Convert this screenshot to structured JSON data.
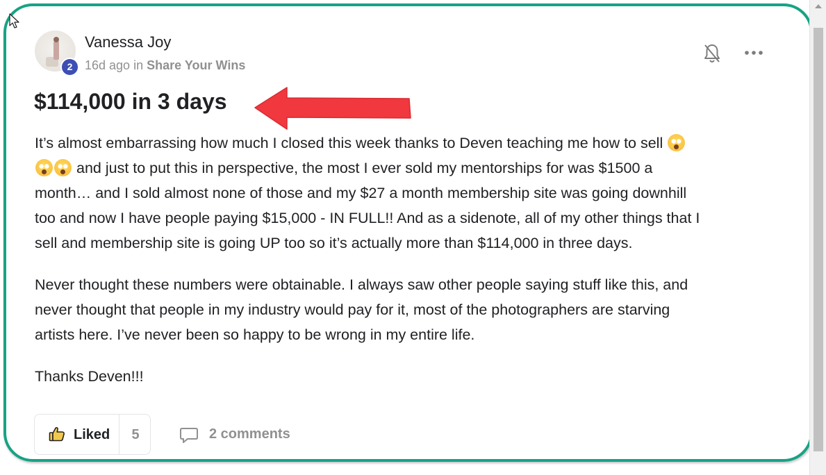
{
  "post": {
    "author": "Vanessa Joy",
    "level": "2",
    "time": "16d ago",
    "in_word": "in",
    "category": "Share Your Wins",
    "title": "$114,000 in 3 days",
    "paragraph1_lines": [
      "It’s almost embarrassing how much I closed this week thanks to Deven teaching me how to sell",
      "and just to put this in perspective, the most I ever sold my mentorships for was $1500 a",
      "month… and I sold almost none of those and my $27 a month membership site was going downhill",
      "too and now I have people paying $15,000 - IN FULL!! And as a sidenote, all of my other things that I",
      "sell and membership site is going UP too so it’s actually more than $114,000 in three days."
    ],
    "paragraph2_lines": [
      "Never thought these numbers were obtainable. I always saw other people saying stuff like this, and",
      "never thought that people in my industry would pay for it, most of the photographers are starving",
      "artists here. I’ve never been so happy to be wrong in my entire life."
    ],
    "paragraph3": "Thanks Deven!!!",
    "emoji_icon": "flushed-face-emoji"
  },
  "actions": {
    "like_label": "Liked",
    "like_count": "5",
    "comments_label": "2 comments"
  },
  "colors": {
    "highlight_frame": "#17a285",
    "arrow": "#f0383e",
    "level_badge": "#3d4eb5",
    "muted_text": "#909090"
  }
}
